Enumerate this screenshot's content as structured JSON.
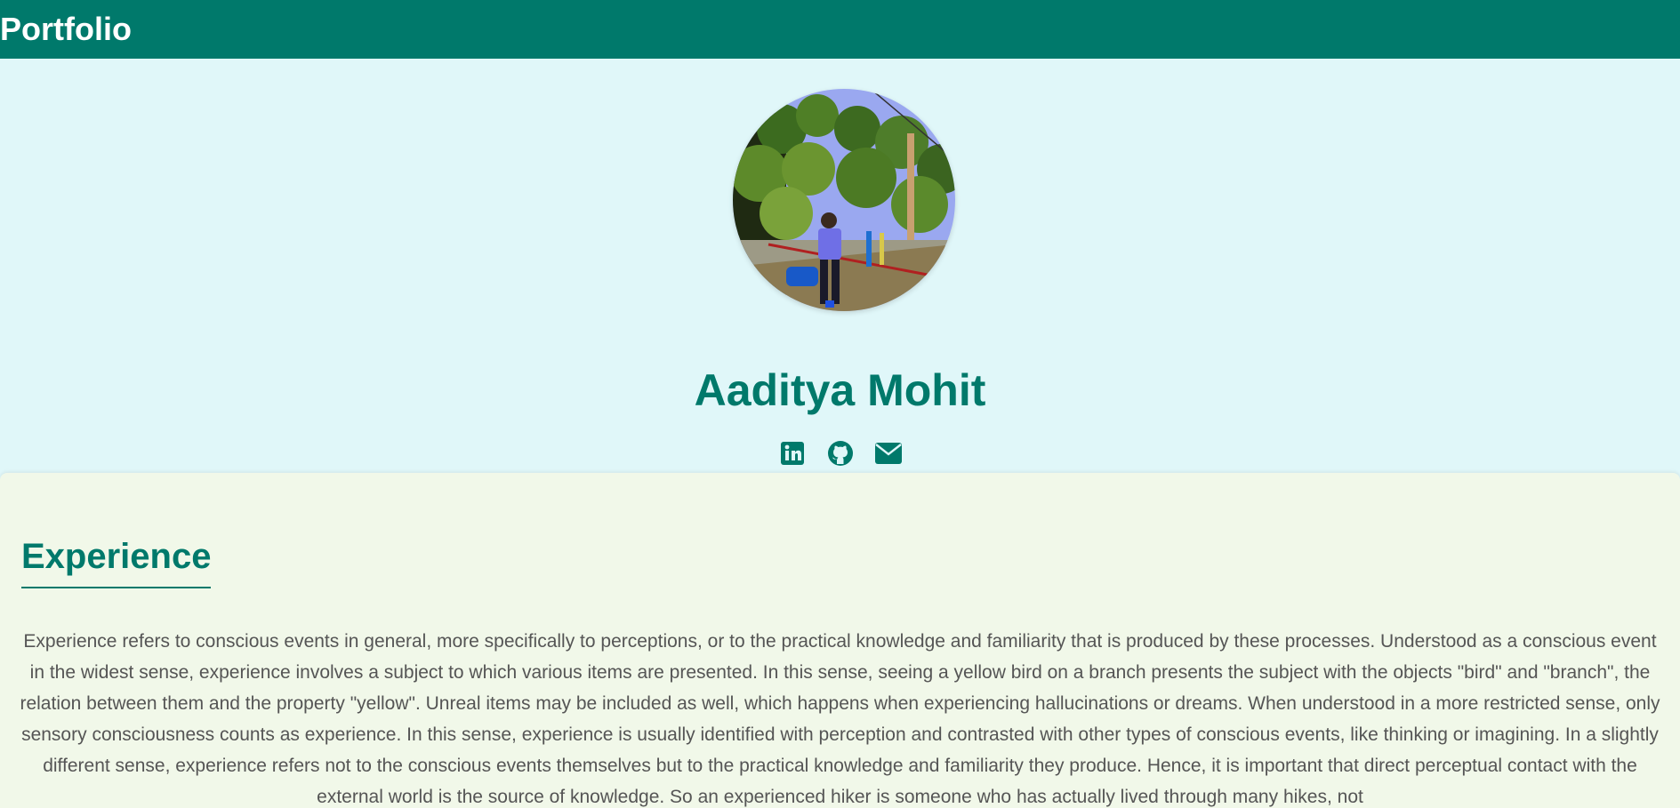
{
  "navbar": {
    "brand": "Portfolio"
  },
  "profile": {
    "name": "Aaditya Mohit",
    "socials": [
      {
        "icon": "linkedin-icon"
      },
      {
        "icon": "github-icon"
      },
      {
        "icon": "email-icon"
      }
    ]
  },
  "experience": {
    "title": "Experience",
    "text": "Experience refers to conscious events in general, more specifically to perceptions, or to the practical knowledge and familiarity that is produced by these processes. Understood as a conscious event in the widest sense, experience involves a subject to which various items are presented. In this sense, seeing a yellow bird on a branch presents the subject with the objects \"bird\" and \"branch\", the relation between them and the property \"yellow\". Unreal items may be included as well, which happens when experiencing hallucinations or dreams. When understood in a more restricted sense, only sensory consciousness counts as experience. In this sense, experience is usually identified with perception and contrasted with other types of conscious events, like thinking or imagining. In a slightly different sense, experience refers not to the conscious events themselves but to the practical knowledge and familiarity they produce. Hence, it is important that direct perceptual contact with the external world is the source of knowledge. So an experienced hiker is someone who has actually lived through many hikes, not"
  },
  "colors": {
    "primary": "#00796b",
    "hero_bg": "#e0f7f9",
    "content_bg": "#f1f8e9",
    "text": "#555555"
  }
}
